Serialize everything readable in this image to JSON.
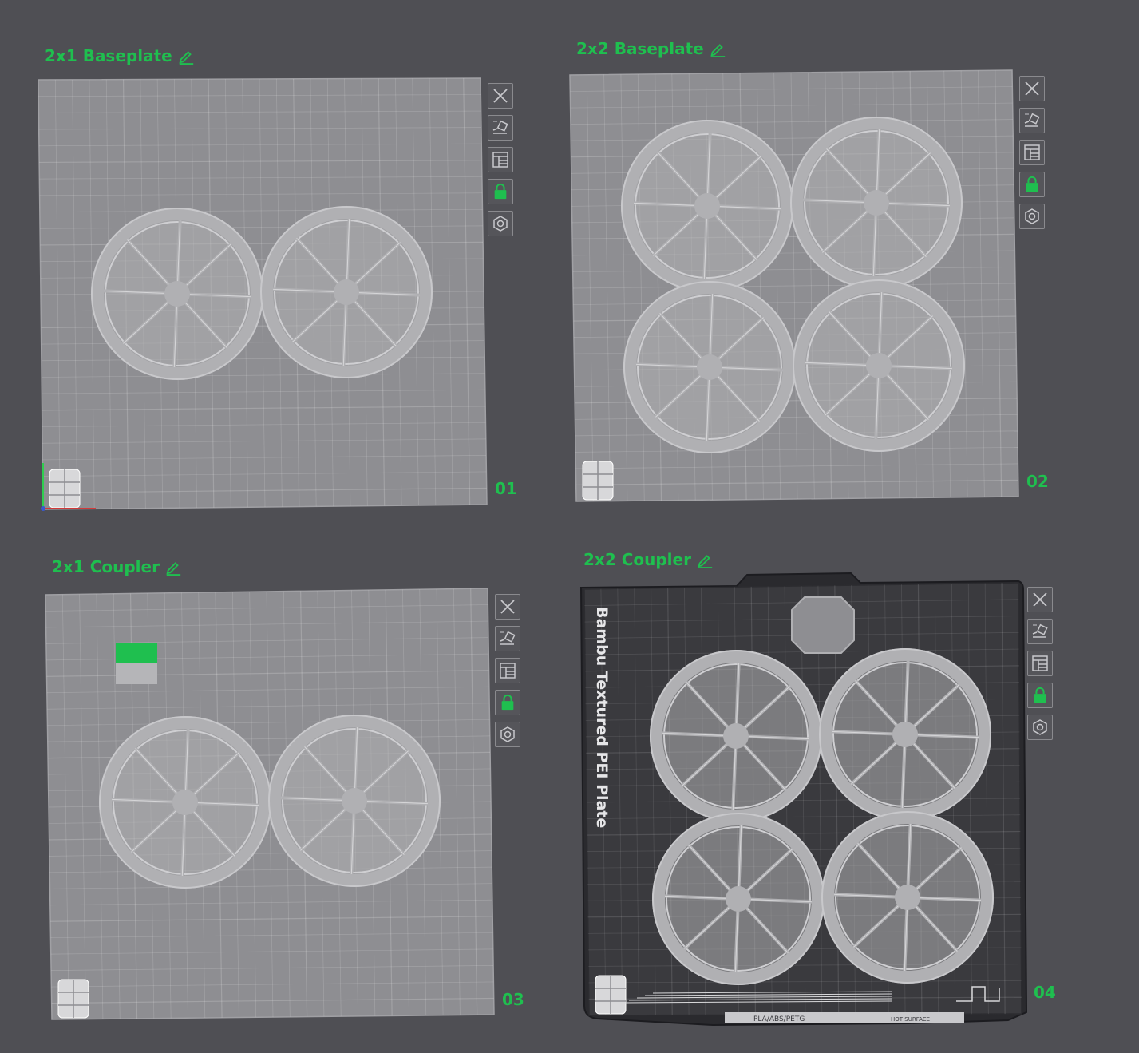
{
  "colors": {
    "background": "#4f4f54",
    "accent_green": "#1fbf4f",
    "bed_light": "#8e8e92",
    "bed_dark": "#3a3a3e",
    "part": "#b0b0b3"
  },
  "plates": [
    {
      "title": "2x1 Baseplate",
      "number": "01"
    },
    {
      "title": "2x2 Baseplate",
      "number": "02"
    },
    {
      "title": "2x1 Coupler",
      "number": "03"
    },
    {
      "title": "2x2 Coupler",
      "number": "04"
    }
  ],
  "plate_icons": {
    "edit": "pencil-icon",
    "close": "close-icon",
    "auto_orient": "auto-orient-icon",
    "arrange": "arrange-icon",
    "lock": "lock-icon",
    "settings": "hexagon-icon"
  },
  "bed4": {
    "brand_text": "Bambu Textured PEI Plate",
    "filament_label": "PLA/ABS/PETG",
    "warning_label": "HOT SURFACE"
  }
}
